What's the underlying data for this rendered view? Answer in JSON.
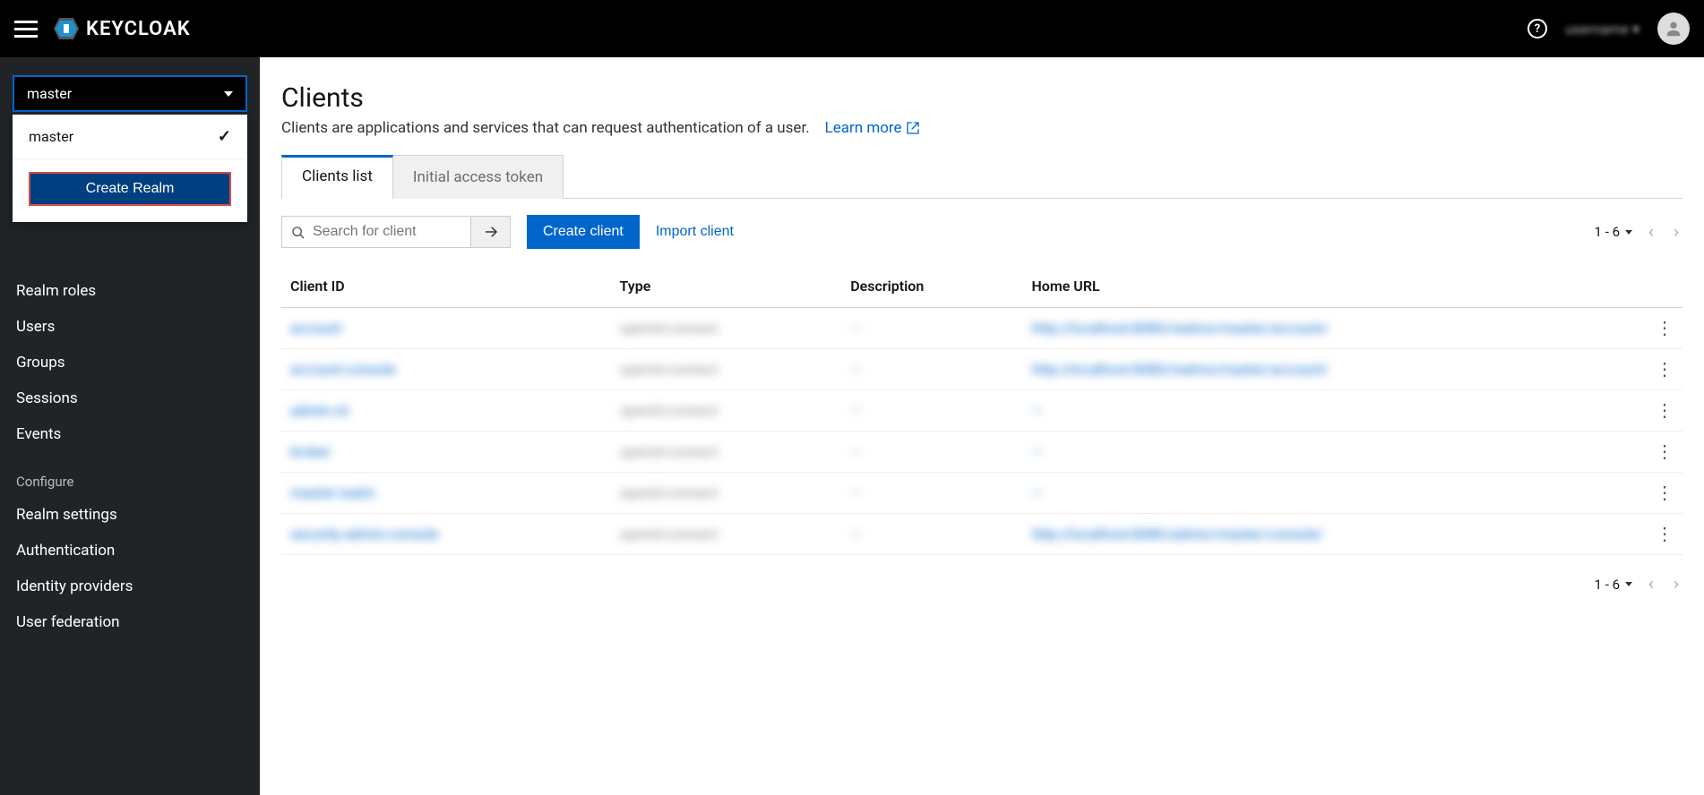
{
  "brand": "KEYCLOAK",
  "user_display": "username ▾",
  "realm_selector": {
    "current": "master",
    "options": [
      "master"
    ],
    "create_btn": "Create Realm"
  },
  "sidebar": {
    "manage": [
      "Realm roles",
      "Users",
      "Groups",
      "Sessions",
      "Events"
    ],
    "configure_heading": "Configure",
    "configure": [
      "Realm settings",
      "Authentication",
      "Identity providers",
      "User federation"
    ]
  },
  "page": {
    "title": "Clients",
    "subtitle": "Clients are applications and services that can request authentication of a user.",
    "learn_more": "Learn more"
  },
  "tabs": [
    "Clients list",
    "Initial access token"
  ],
  "active_tab": 0,
  "toolbar": {
    "search_placeholder": "Search for client",
    "create_client": "Create client",
    "import_client": "Import client",
    "range": "1 - 6"
  },
  "table": {
    "headers": [
      "Client ID",
      "Type",
      "Description",
      "Home URL"
    ],
    "rows": [
      {
        "client_id": "account",
        "type": "openid-connect",
        "description": "—",
        "home_url": "http://localhost:8080/realms/master/account/"
      },
      {
        "client_id": "account-console",
        "type": "openid-connect",
        "description": "—",
        "home_url": "http://localhost:8080/realms/master/account/"
      },
      {
        "client_id": "admin-cli",
        "type": "openid-connect",
        "description": "—",
        "home_url": "—"
      },
      {
        "client_id": "broker",
        "type": "openid-connect",
        "description": "—",
        "home_url": "—"
      },
      {
        "client_id": "master-realm",
        "type": "openid-connect",
        "description": "—",
        "home_url": "—"
      },
      {
        "client_id": "security-admin-console",
        "type": "openid-connect",
        "description": "—",
        "home_url": "http://localhost:8080/admin/master/console/"
      }
    ]
  }
}
